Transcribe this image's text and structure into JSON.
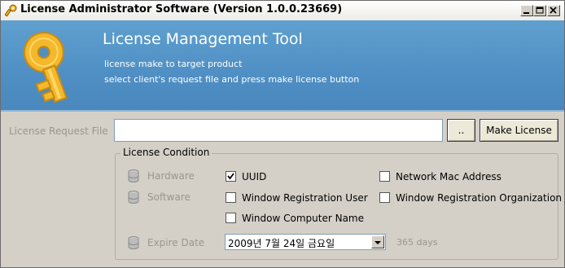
{
  "window": {
    "title": "License Administrator Software (Version 1.0.0.23669)"
  },
  "header": {
    "title": "License Management Tool",
    "line1": "license make to target product",
    "line2": "select client's request file and  press make license button"
  },
  "request": {
    "label": "License Request File",
    "value": "",
    "browse_label": "..",
    "make_label": "Make License"
  },
  "condition": {
    "title": "License Condition",
    "hardware_label": "Hardware",
    "software_label": "Software",
    "expire_label": "Expire Date",
    "options": [
      {
        "label": "UUID",
        "checked": true
      },
      {
        "label": "Network Mac Address",
        "checked": false
      },
      {
        "label": "Window Registration User",
        "checked": false
      },
      {
        "label": "Window Registration Organization",
        "checked": false
      },
      {
        "label": "Window Computer Name",
        "checked": false
      }
    ],
    "expire_date": "2009년   7월 24일 금요일",
    "days": "365 days"
  },
  "colors": {
    "header_blue": "#5fa0cf",
    "window_bg": "#d4d0c8",
    "key_gold": "#f2b62b"
  }
}
